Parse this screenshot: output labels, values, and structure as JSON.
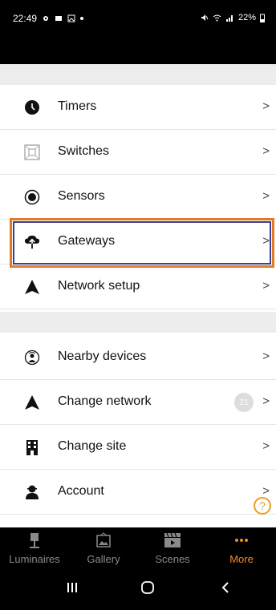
{
  "status_bar": {
    "time": "22:49",
    "battery": "22%"
  },
  "menu_section_1": [
    {
      "label": "Timers",
      "icon": "clock-icon",
      "chevron": ">"
    },
    {
      "label": "Switches",
      "icon": "switch-icon",
      "chevron": ">"
    },
    {
      "label": "Sensors",
      "icon": "sensor-icon",
      "chevron": ">"
    },
    {
      "label": "Gateways",
      "icon": "cloud-upload-icon",
      "chevron": ">"
    },
    {
      "label": "Network setup",
      "icon": "network-arrow-icon",
      "chevron": ">"
    }
  ],
  "menu_section_2": [
    {
      "label": "Nearby devices",
      "icon": "nearby-icon",
      "chevron": ">"
    },
    {
      "label": "Change network",
      "icon": "network-arrow-icon",
      "chevron": ">",
      "badge": "21"
    },
    {
      "label": "Change site",
      "icon": "building-icon",
      "chevron": ">"
    },
    {
      "label": "Account",
      "icon": "person-icon",
      "chevron": ">"
    }
  ],
  "help": "?",
  "tabs": [
    {
      "label": "Luminaires",
      "icon": "lamp-icon",
      "active": false
    },
    {
      "label": "Gallery",
      "icon": "gallery-icon",
      "active": false
    },
    {
      "label": "Scenes",
      "icon": "scenes-icon",
      "active": false
    },
    {
      "label": "More",
      "icon": "more-dots-icon",
      "active": true
    }
  ],
  "colors": {
    "accent": "#f08a22",
    "highlight_outer": "#e07b26",
    "highlight_inner": "#3a3f8f"
  }
}
